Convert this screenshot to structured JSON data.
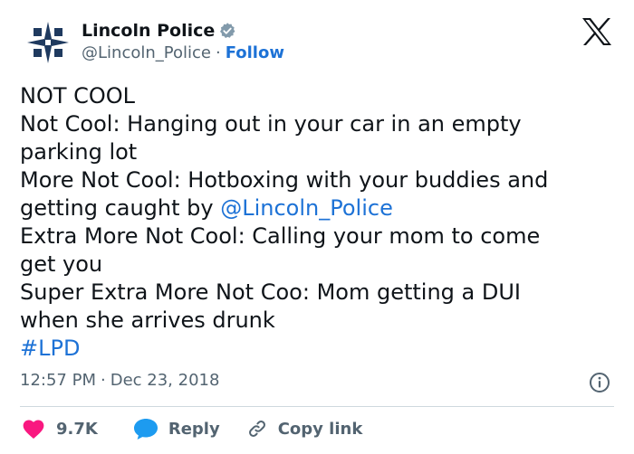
{
  "header": {
    "display_name": "Lincoln Police",
    "handle": "@Lincoln_Police",
    "separator": "·",
    "follow_label": "Follow"
  },
  "tweet": {
    "lines": [
      {
        "text": "NOT COOL"
      },
      {
        "text": "Not Cool: Hanging out in your car in an empty"
      },
      {
        "text": "parking lot"
      },
      {
        "text": "More Not Cool: Hotboxing with your buddies and"
      },
      {
        "text": "getting caught by ",
        "mention": "@Lincoln_Police"
      },
      {
        "text": "Extra More Not Cool: Calling your mom to come"
      },
      {
        "text": "get you"
      },
      {
        "text": "Super Extra More Not Coo: Mom getting a DUI"
      },
      {
        "text": "when she arrives drunk"
      }
    ],
    "hashtag": "#LPD"
  },
  "meta": {
    "time": "12:57 PM",
    "separator": "·",
    "date": "Dec 23, 2018"
  },
  "actions": {
    "like_count": "9.7K",
    "reply_label": "Reply",
    "copy_label": "Copy link"
  },
  "icons": {
    "logo": "lincoln-police-star-logo",
    "verified": "verified-badge-icon",
    "platform": "x-logo-icon",
    "info": "info-icon",
    "like": "heart-icon",
    "reply": "speech-bubble-icon",
    "copy": "link-icon"
  },
  "colors": {
    "link": "#1d72d6",
    "text": "#0f1419",
    "muted": "#536471",
    "heart": "#f91880",
    "reply_bubble": "#1d9bf0",
    "logo_navy": "#1f3a5f",
    "verified_gray": "#829aab"
  }
}
